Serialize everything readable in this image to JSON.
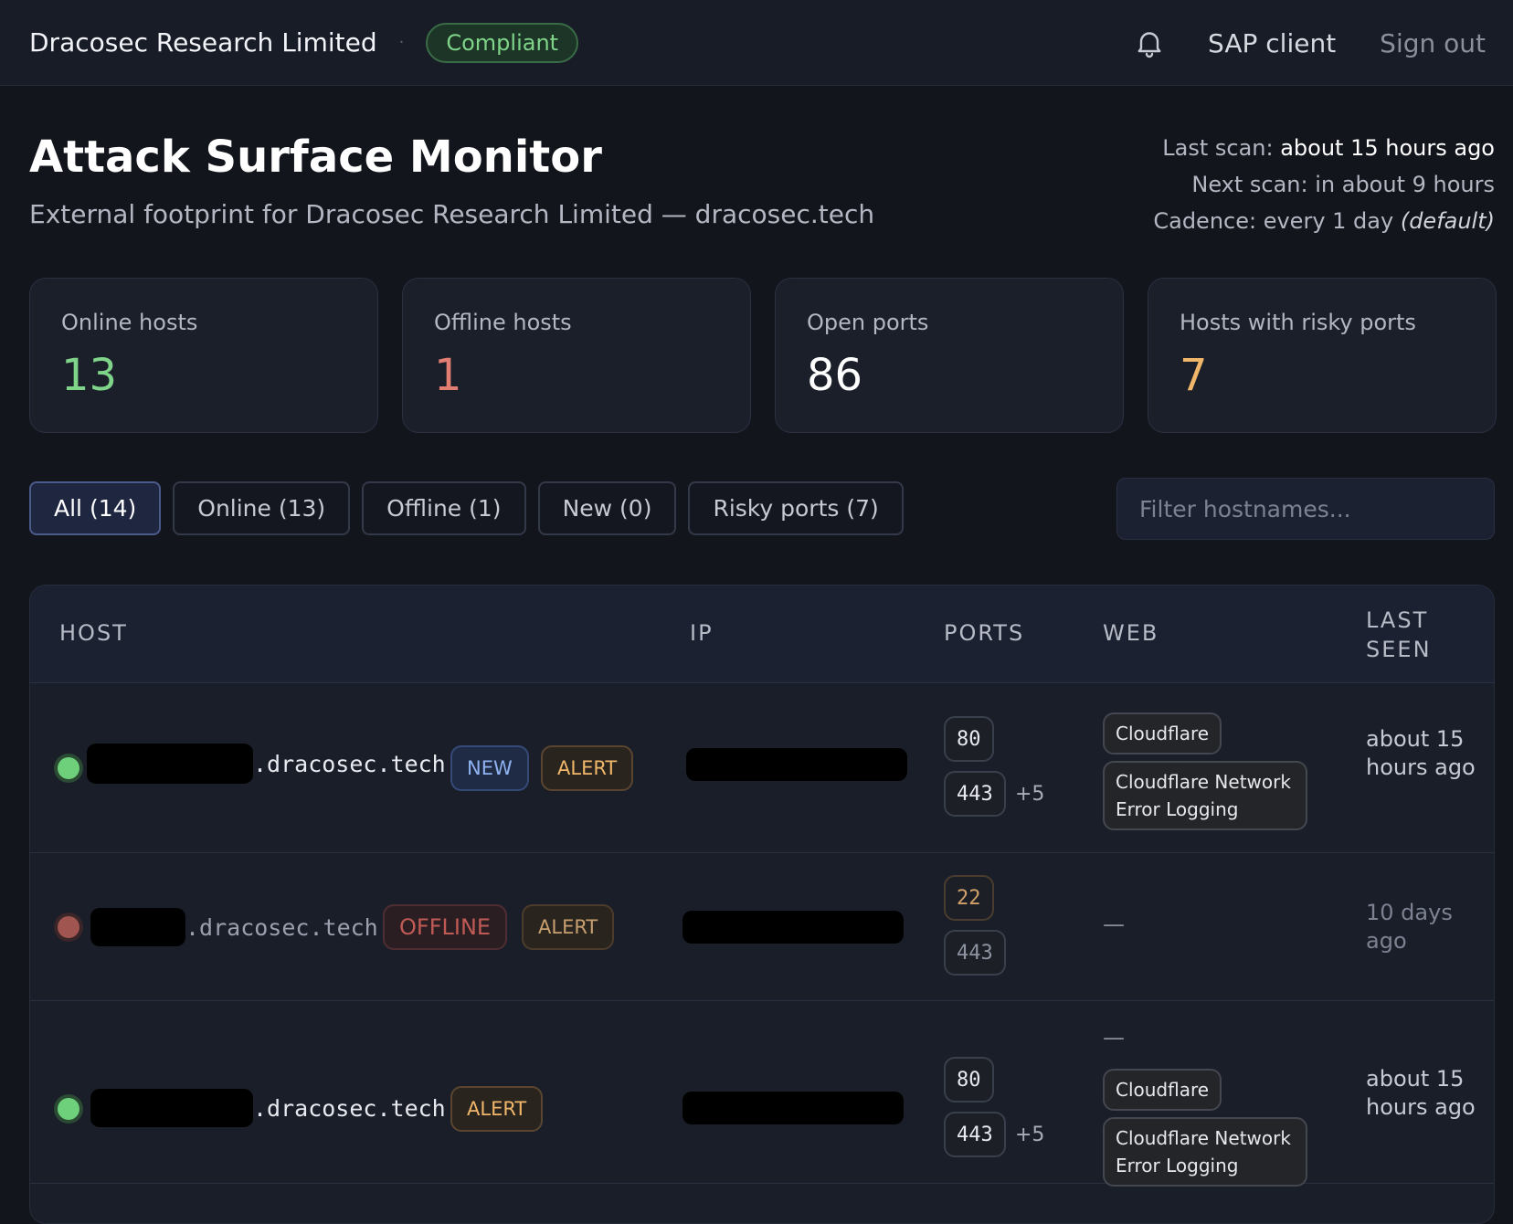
{
  "topbar": {
    "org_name": "Dracosec Research Limited",
    "separator": "·",
    "compliance_badge": "Compliant",
    "user_label": "SAP client",
    "signout_label": "Sign out",
    "icons": [
      "bell-icon"
    ]
  },
  "header": {
    "title": "Attack Surface Monitor",
    "subtitle": "External footprint for Dracosec Research Limited — dracosec.tech",
    "last_scan_label": "Last scan:",
    "last_scan_value": "about 15 hours ago",
    "next_scan": "Next scan: in about 9 hours",
    "cadence": "Cadence: every 1 day",
    "cadence_note": "(default)"
  },
  "stats": [
    {
      "label": "Online hosts",
      "value": "13",
      "color": "#7fd48a"
    },
    {
      "label": "Offline hosts",
      "value": "1",
      "color": "#e27d72"
    },
    {
      "label": "Open ports",
      "value": "86",
      "color": "#ffffff"
    },
    {
      "label": "Hosts with risky ports",
      "value": "7",
      "color": "#f0b66a"
    }
  ],
  "filters": [
    {
      "label": "All (14)",
      "active": true
    },
    {
      "label": "Online (13)",
      "active": false
    },
    {
      "label": "Offline (1)",
      "active": false
    },
    {
      "label": "New (0)",
      "active": false
    },
    {
      "label": "Risky ports (7)",
      "active": false
    }
  ],
  "search": {
    "placeholder": "Filter hostnames...",
    "value": ""
  },
  "table": {
    "columns": [
      "HOST",
      "IP",
      "PORTS",
      "WEB",
      "LAST SEEN"
    ],
    "rows": [
      {
        "status": "online",
        "host_suffix": ".dracosec.tech",
        "badges": [
          "NEW",
          "ALERT"
        ],
        "ports": [
          "80",
          "443"
        ],
        "ports_more": "+5",
        "web": [
          "Cloudflare",
          "Cloudflare Network Error Logging"
        ],
        "last_seen": "about 15 hours ago"
      },
      {
        "status": "offline",
        "host_suffix": ".dracosec.tech",
        "badges": [
          "OFFLINE",
          "ALERT"
        ],
        "ports": [
          "22",
          "443"
        ],
        "ports_more": "",
        "web": [],
        "web_empty": "—",
        "last_seen": "10 days ago"
      },
      {
        "status": "online",
        "host_suffix": ".dracosec.tech",
        "badges": [
          "ALERT"
        ],
        "ports": [
          "80",
          "443"
        ],
        "ports_more": "+5",
        "web_prefix": "—",
        "web": [
          "Cloudflare",
          "Cloudflare Network Error Logging"
        ],
        "last_seen": "about 15 hours ago"
      }
    ]
  }
}
